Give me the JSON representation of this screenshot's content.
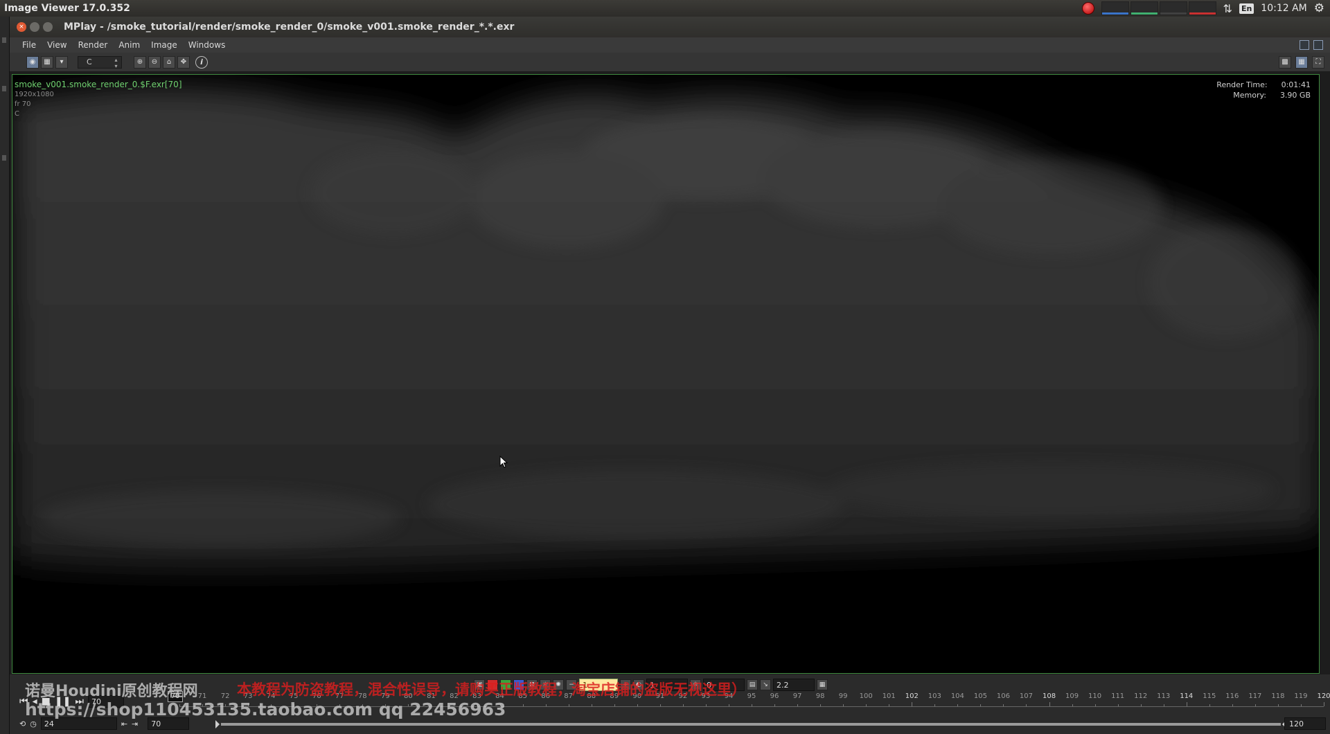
{
  "system_bar": {
    "app_title": "Image Viewer 17.0.352",
    "keyboard_layout": "En",
    "clock": "10:12 AM"
  },
  "window": {
    "title": "MPlay - /smoke_tutorial/render/smoke_render_0/smoke_v001.smoke_render_*.*.exr"
  },
  "menu": {
    "items": [
      "File",
      "View",
      "Render",
      "Anim",
      "Image",
      "Windows"
    ]
  },
  "toolbar": {
    "channel": "C"
  },
  "viewport": {
    "file_label": "smoke_v001.smoke_render_0.$F.exr[70]",
    "resolution": "1920x1080",
    "frame": "fr 70",
    "channel": "C",
    "render_time_label": "Render Time:",
    "render_time_value": "0:01:41",
    "memory_label": "Memory:",
    "memory_value": "3.90 GB"
  },
  "display_controls": {
    "gamma_field": "1",
    "exposure_field": "1",
    "offset_field": "0",
    "lut_value": "2.2"
  },
  "transport": {
    "current_frame": "70",
    "current_frame_marker": "70",
    "fps": "24",
    "range_start": "70",
    "range_end": "120"
  },
  "timeline": {
    "start": 70,
    "end": 120,
    "major_ticks": [
      102,
      108,
      114,
      120
    ]
  },
  "watermark": {
    "line1": "诺曼Houdini原创教程网",
    "line1_red": "本教程为防盗教程，混合性误导，请购买正版教程，淘宝店铺的盗版无视这里）",
    "line2": "https://shop110453135.taobao.com  qq 22456963"
  },
  "colors": {
    "viewport_border": "#3f8a3f",
    "file_label": "#6fd06f",
    "gamma_field_bg": "#ffe9a0",
    "watermark_red": "#dc1e1e"
  }
}
